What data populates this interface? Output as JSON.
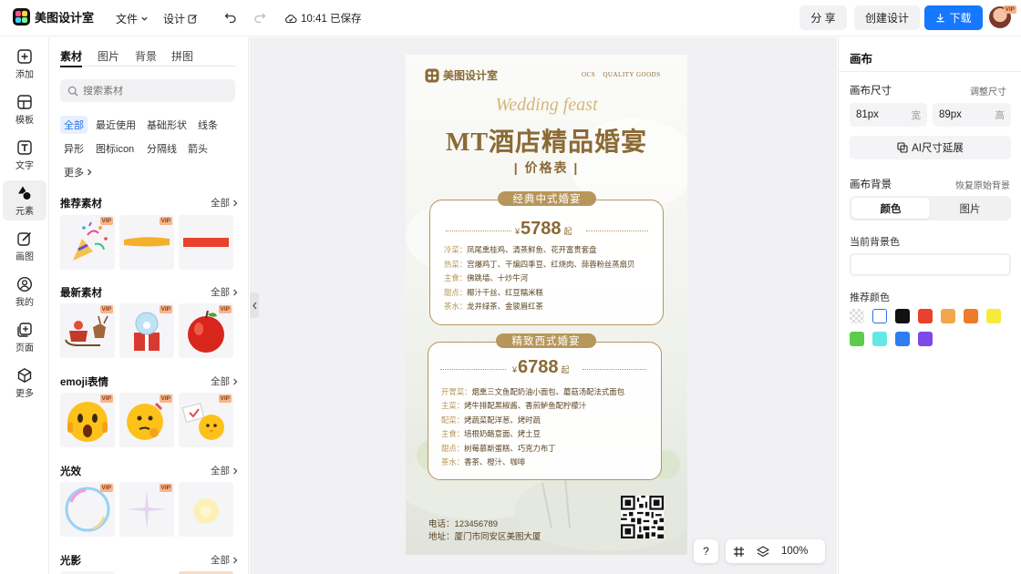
{
  "app": {
    "name": "美图设计室"
  },
  "topbar": {
    "file_label": "文件",
    "design_label": "设计",
    "save_status": "10:41 已保存",
    "share_label": "分 享",
    "create_label": "创建设计",
    "download_label": "下载",
    "avatar_badge": "VIP"
  },
  "rail": {
    "items": [
      {
        "label": "添加",
        "icon": "plus-square-icon"
      },
      {
        "label": "模板",
        "icon": "template-icon"
      },
      {
        "label": "文字",
        "icon": "text-icon"
      },
      {
        "label": "元素",
        "icon": "shapes-icon"
      },
      {
        "label": "画图",
        "icon": "pencil-icon"
      },
      {
        "label": "我的",
        "icon": "user-icon"
      },
      {
        "label": "页面",
        "icon": "page-add-icon"
      },
      {
        "label": "更多",
        "icon": "cube-icon"
      }
    ],
    "active_index": 3
  },
  "assets": {
    "tabs": [
      "素材",
      "图片",
      "背景",
      "拼图"
    ],
    "search_placeholder": "搜索素材",
    "chips": [
      "全部",
      "最近使用",
      "基础形状",
      "线条",
      "异形",
      "图标icon",
      "分隔线",
      "箭头",
      "更多"
    ],
    "all_label": "全部",
    "vip": "VIP",
    "sections": [
      {
        "title": "推荐素材"
      },
      {
        "title": "最新素材"
      },
      {
        "title": "emoji表情"
      },
      {
        "title": "光效"
      },
      {
        "title": "光影"
      }
    ]
  },
  "poster": {
    "brand": "美图设计室",
    "tagline_cn": "OCS",
    "tagline_en": "QUALITY GOODS",
    "script_title": "Wedding feast",
    "main_title": "MT酒店精品婚宴",
    "subtitle": "| 价格表 |",
    "menu1": {
      "ribbon": "经典中式婚宴",
      "currency": "¥",
      "price": "5788",
      "suffix": "起",
      "lines": [
        {
          "k": "冷菜：",
          "v": "凤尾熏桂鸡、清蒸鲜鱼、花开富贵套盘"
        },
        {
          "k": "热菜：",
          "v": "宫爆鸡丁、干煸四季豆、红烧肉、蒜蓉粉丝蒸扇贝"
        },
        {
          "k": "主食：",
          "v": "佛跳墙、十炒牛河"
        },
        {
          "k": "甜点：",
          "v": "椰汁千丝、红豆糯米糕"
        },
        {
          "k": "茶水：",
          "v": "龙井绿茶、金骏眉红茶"
        }
      ]
    },
    "menu2": {
      "ribbon": "精致西式婚宴",
      "currency": "¥",
      "price": "6788",
      "suffix": "起",
      "lines": [
        {
          "k": "开胃菜：",
          "v": "烟熏三文鱼配奶油小面包、蘑菇汤配法式面包"
        },
        {
          "k": "主菜：",
          "v": "烤牛排配黑椒酱、香煎鲈鱼配柠檬汁"
        },
        {
          "k": "配菜：",
          "v": "烤蔬菜配洋葱、烤时蔬"
        },
        {
          "k": "主食：",
          "v": "培根奶酪意面、烤土豆"
        },
        {
          "k": "甜点：",
          "v": "树莓慕斯蛋糕、巧克力布丁"
        },
        {
          "k": "茶水：",
          "v": "香茶、橙汁、咖啡"
        }
      ]
    },
    "phone": "电话：123456789",
    "address": "地址：厦门市同安区美图大厦"
  },
  "controls": {
    "help": "?",
    "zoom": "100%"
  },
  "right": {
    "title": "画布",
    "size_label": "画布尺寸",
    "resize_link": "调整尺寸",
    "width_value": "81px",
    "width_unit": "宽",
    "height_value": "89px",
    "height_unit": "高",
    "ai_extend_label": "AI尺寸延展",
    "bg_label": "画布背景",
    "restore_link": "恢复原始背景",
    "seg_color": "颜色",
    "seg_image": "图片",
    "current_bg_label": "当前背景色",
    "current_bg_value": "",
    "recommended_label": "推荐颜色",
    "swatches": [
      "transparent",
      "#ffffff",
      "#111111",
      "#e8412c",
      "#f2a84a",
      "#ee7b2a",
      "#f8ea3c",
      "#5ccc4a",
      "#63e8e6",
      "#2d7ef2",
      "#7c4ae8"
    ]
  },
  "colors": {
    "accent": "#1677ff",
    "gold": "#b8965a",
    "brown": "#8b6a35"
  }
}
